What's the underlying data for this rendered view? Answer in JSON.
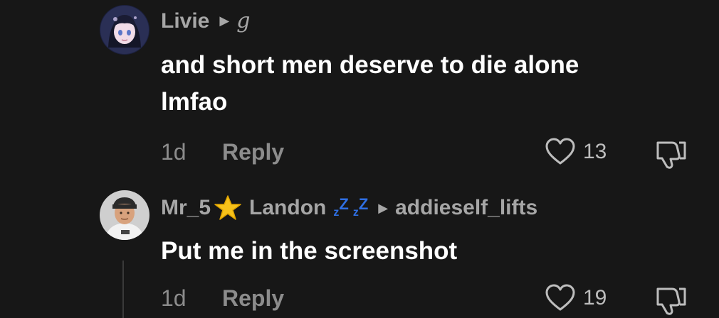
{
  "comments": [
    {
      "author": "Livie",
      "reply_to": "g",
      "text_line1": "and short men deserve to die alone",
      "text_line2": "lmfao",
      "time": "1d",
      "reply_label": "Reply",
      "likes": "13",
      "avatar": "anime-girl-avatar"
    },
    {
      "author_part1": "Mr_5",
      "author_part2": "Landon",
      "reply_to": "addieself_lifts",
      "text": "Put me in the screenshot",
      "time": "1d",
      "reply_label": "Reply",
      "likes": "19",
      "avatar": "man-cap-avatar",
      "decorations": [
        "star-emoji",
        "zzz-emoji"
      ]
    }
  ],
  "colors": {
    "background": "#171717",
    "primary_text": "#ffffff",
    "secondary_text": "#a6a6a6",
    "zzz_blue": "#2f6fe3",
    "star_yellow": "#f7c21a"
  }
}
